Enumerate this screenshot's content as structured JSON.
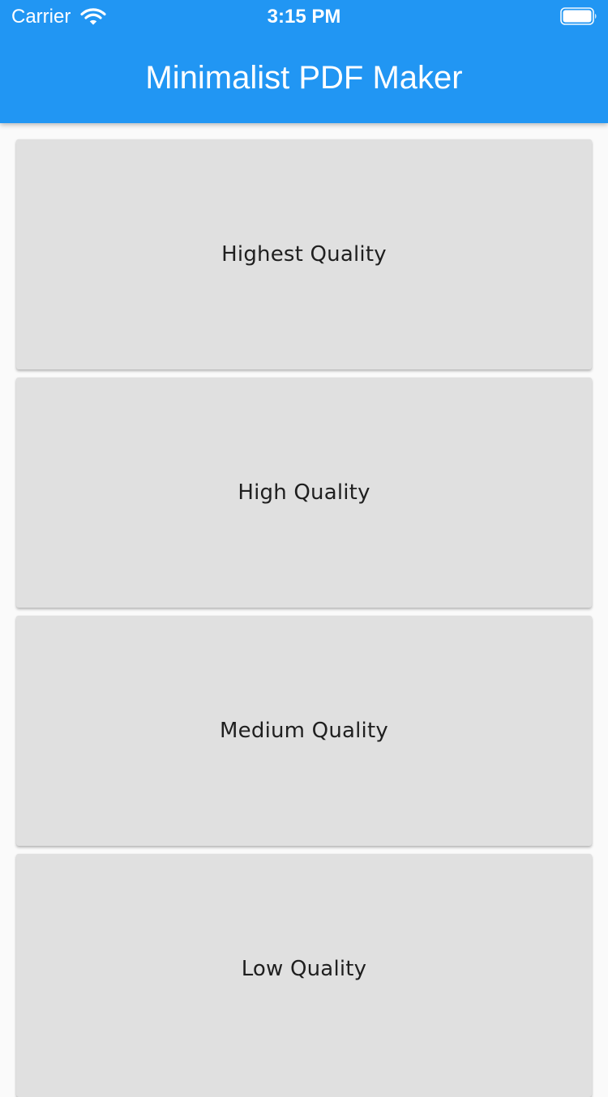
{
  "status_bar": {
    "carrier": "Carrier",
    "time": "3:15 PM",
    "icons": [
      "wifi-icon",
      "battery-icon"
    ]
  },
  "app_bar": {
    "title": "Minimalist PDF Maker",
    "color": "#2196F3"
  },
  "quality_options": [
    {
      "label": "Highest Quality"
    },
    {
      "label": "High Quality"
    },
    {
      "label": "Medium Quality"
    },
    {
      "label": "Low Quality"
    }
  ],
  "colors": {
    "card_background": "#E0E0E0",
    "page_background": "#FAFAFA",
    "text": "#1F1F1F"
  }
}
